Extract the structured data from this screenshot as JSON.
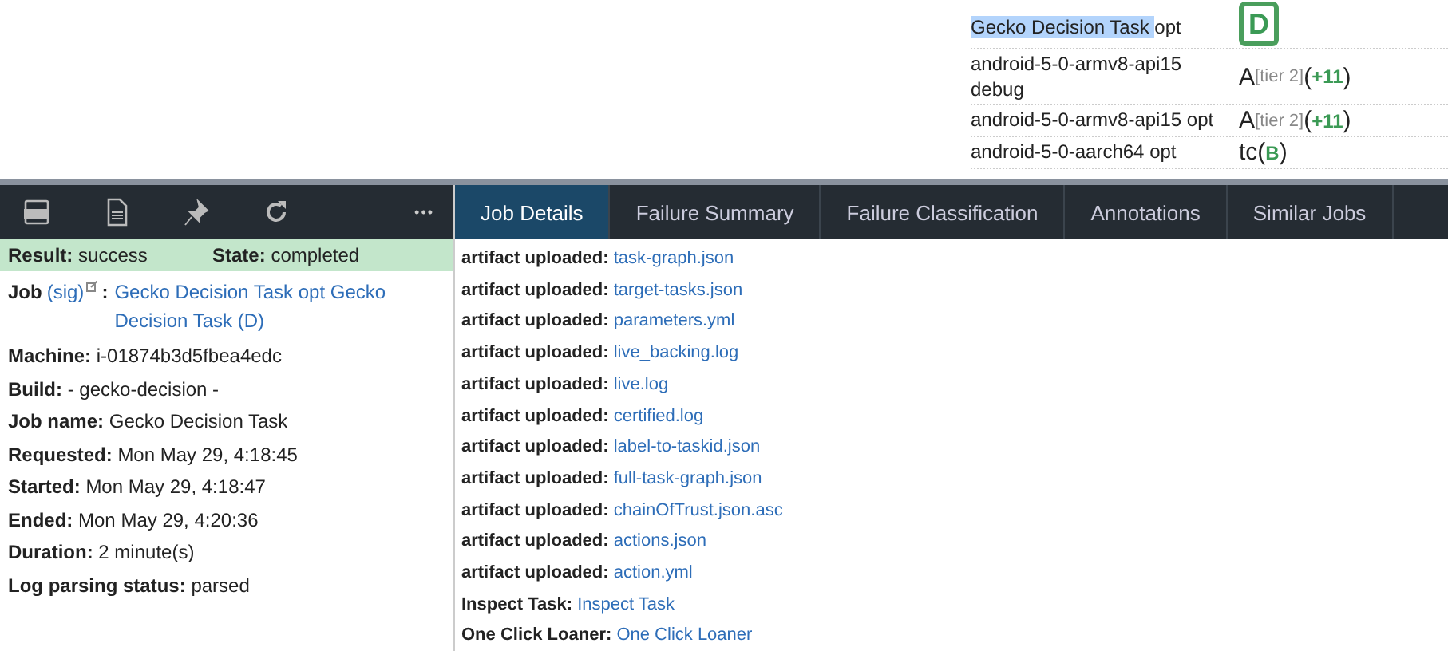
{
  "push_rows": [
    {
      "highlight": "Gecko Decision Task",
      "text": "opt",
      "job": {
        "kind": "selected",
        "symbol": "D"
      }
    },
    {
      "text": "android-5-0-armv8-api15 debug",
      "job": {
        "kind": "group",
        "symbol": "A",
        "tier": "[tier 2]",
        "open": "(",
        "count": "+11",
        "close": ")"
      }
    },
    {
      "text": "android-5-0-armv8-api15 opt",
      "job": {
        "kind": "group",
        "symbol": "A",
        "tier": "[tier 2]",
        "open": "(",
        "count": "+11",
        "close": ")"
      }
    },
    {
      "text": "android-5-0-aarch64 opt",
      "job": {
        "kind": "group",
        "symbol": "tc",
        "open": "(",
        "count": "B",
        "close": ")"
      }
    }
  ],
  "summary": {
    "result_label": "Result:",
    "result": "success",
    "state_label": "State:",
    "state": "completed",
    "job_label": "Job",
    "sig": "(sig)",
    "colon": ":",
    "job_link": "Gecko Decision Task opt Gecko Decision Task (D)",
    "fields": [
      {
        "label": "Machine:",
        "value": "i-01874b3d5fbea4edc"
      },
      {
        "label": "Build:",
        "value": "- gecko-decision -"
      },
      {
        "label": "Job name:",
        "value": "Gecko Decision Task"
      },
      {
        "label": "Requested:",
        "value": "Mon May 29, 4:18:45"
      },
      {
        "label": "Started:",
        "value": "Mon May 29, 4:18:47"
      },
      {
        "label": "Ended:",
        "value": "Mon May 29, 4:20:36"
      },
      {
        "label": "Duration:",
        "value": "2 minute(s)"
      },
      {
        "label": "Log parsing status:",
        "value": "parsed"
      }
    ]
  },
  "tabs": [
    {
      "label": "Job Details",
      "selected": true
    },
    {
      "label": "Failure Summary",
      "selected": false
    },
    {
      "label": "Failure Classification",
      "selected": false
    },
    {
      "label": "Annotations",
      "selected": false
    },
    {
      "label": "Similar Jobs",
      "selected": false
    }
  ],
  "toolbar_more": "•••",
  "details": [
    {
      "label": "artifact uploaded:",
      "link": "task-graph.json"
    },
    {
      "label": "artifact uploaded:",
      "link": "target-tasks.json"
    },
    {
      "label": "artifact uploaded:",
      "link": "parameters.yml"
    },
    {
      "label": "artifact uploaded:",
      "link": "live_backing.log"
    },
    {
      "label": "artifact uploaded:",
      "link": "live.log"
    },
    {
      "label": "artifact uploaded:",
      "link": "certified.log"
    },
    {
      "label": "artifact uploaded:",
      "link": "label-to-taskid.json"
    },
    {
      "label": "artifact uploaded:",
      "link": "full-task-graph.json"
    },
    {
      "label": "artifact uploaded:",
      "link": "chainOfTrust.json.asc"
    },
    {
      "label": "artifact uploaded:",
      "link": "actions.json"
    },
    {
      "label": "artifact uploaded:",
      "link": "action.yml"
    },
    {
      "label": "Inspect Task:",
      "link": "Inspect Task"
    },
    {
      "label": "One Click Loaner:",
      "link": "One Click Loaner"
    }
  ]
}
